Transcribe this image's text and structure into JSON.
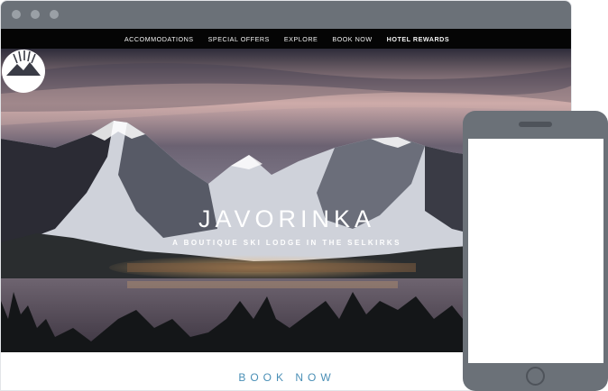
{
  "site": {
    "nav": [
      {
        "label": "Accommodations"
      },
      {
        "label": "Special Offers"
      },
      {
        "label": "Explore"
      },
      {
        "label": "Book Now"
      },
      {
        "label": "Hotel Rewards"
      }
    ],
    "brand_name": "JAVORINKA",
    "tagline": "A BOUTIQUE SKI LODGE IN THE SELKIRKS",
    "book_now": "BOOK NOW"
  },
  "colors": {
    "chrome": "#6b7178",
    "nav_background": "#050505",
    "book_now_accent": "#4a8fb6"
  },
  "icons": {
    "brand_logo": "mountain-sun-logo-icon"
  }
}
